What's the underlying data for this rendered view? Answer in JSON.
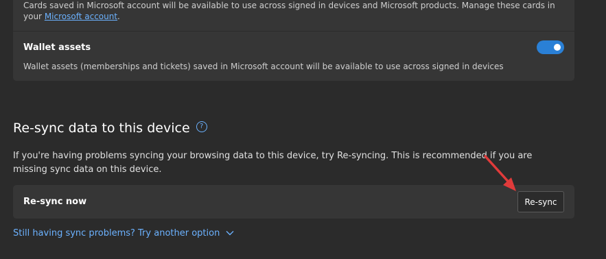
{
  "cards_section": {
    "description": "Cards saved in Microsoft account will be available to use across signed in devices and Microsoft products. Manage these cards in your",
    "link_text": "Microsoft account",
    "link_suffix": "."
  },
  "wallet": {
    "title": "Wallet assets",
    "description": "Wallet assets (memberships and tickets) saved in Microsoft account will be available to use across signed in devices",
    "toggle_on": true,
    "toggle_color": "#2a80d6"
  },
  "resync_section": {
    "title": "Re-sync data to this device",
    "help_icon": "?",
    "description": "If you're having problems syncing your browsing data to this device, try Re-syncing. This is recommended if you are missing sync data on this device.",
    "row_label": "Re-sync now",
    "button_label": "Re-sync",
    "more_link": "Still having sync problems? Try another option"
  },
  "colors": {
    "background": "#2b2b2b",
    "card": "#363636",
    "link": "#6cb2ff",
    "annotation_arrow": "#e03b3b"
  }
}
